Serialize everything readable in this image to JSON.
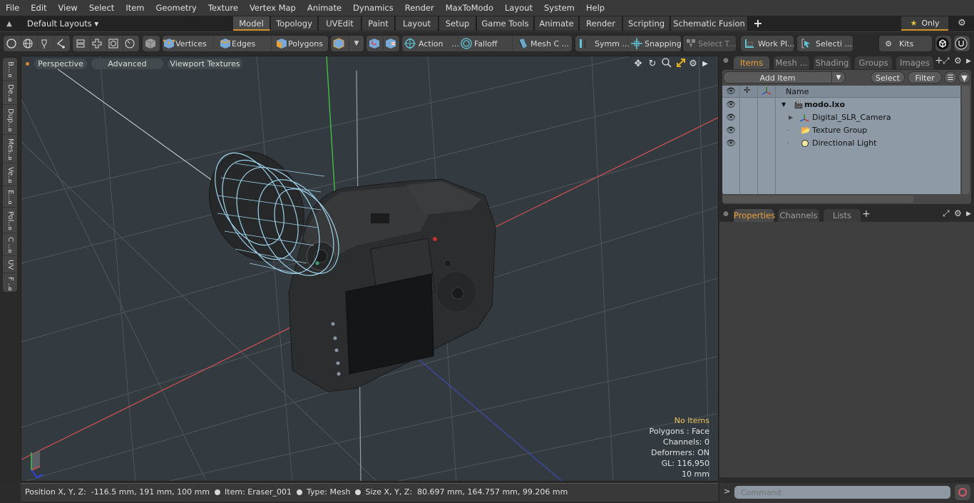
{
  "menu": [
    "File",
    "Edit",
    "View",
    "Select",
    "Item",
    "Geometry",
    "Texture",
    "Vertex Map",
    "Animate",
    "Dynamics",
    "Render",
    "MaxToModo",
    "Layout",
    "System",
    "Help"
  ],
  "layouts": {
    "label": "Default Layouts ▾",
    "tabs": [
      "Model",
      "Topology",
      "UVEdit",
      "Paint",
      "Layout",
      "Setup",
      "Game Tools",
      "Animate",
      "Render",
      "Scripting",
      "Schematic Fusion"
    ],
    "active_tab": "Model",
    "add": "+",
    "only_label": "Only"
  },
  "toolbar": {
    "vertices": "Vertices",
    "edges": "Edges",
    "polygons": "Polygons",
    "action": "Action",
    "falloff": "Falloff",
    "mesh": "Mesh C ...",
    "symmetry": "Symm ...",
    "snapping": "Snapping",
    "select_t": "Select T...",
    "work_plane": "Work Pl...",
    "selection": "Selecti ...",
    "kits": "Kits",
    "ellipsis": "..."
  },
  "left_tabs": [
    "B...",
    "De...",
    "Dup...",
    "Mes...",
    "Ve...",
    "E...",
    "Pol...",
    "C ...",
    "UV",
    "F ..."
  ],
  "viewport": {
    "view_mode": "Perspective",
    "shading": "Advanced",
    "textures": "Viewport Textures",
    "info": {
      "selection": "No Items",
      "polygons": "Polygons : Face",
      "channels": "Channels: 0",
      "deformers": "Deformers: ON",
      "gl": "GL: 116,950",
      "grid": "10 mm"
    }
  },
  "items_panel": {
    "tabs": [
      "Items",
      "Mesh ...",
      "Shading",
      "Groups",
      "Images"
    ],
    "active_tab": "Items",
    "add_item": "Add Item",
    "select": "Select",
    "filter": "Filter",
    "column_name": "Name",
    "tree": [
      {
        "name": "modo.lxo",
        "icon": "scene-clapper-icon",
        "level": 0,
        "expanded": true,
        "bold": true
      },
      {
        "name": "Digital_SLR_Camera",
        "icon": "locator-icon",
        "level": 1,
        "expanded": false
      },
      {
        "name": "Texture Group",
        "icon": "folder-icon",
        "level": 1
      },
      {
        "name": "Directional Light",
        "icon": "light-icon",
        "level": 1
      }
    ]
  },
  "properties_panel": {
    "tabs": [
      "Properties",
      "Channels",
      "Lists"
    ],
    "active_tab": "Properties",
    "add": "+"
  },
  "command": {
    "prompt": ">",
    "placeholder": "Command"
  },
  "status": {
    "position_label": "Position X, Y, Z:",
    "position_value": "-116.5 mm, 191 mm, 100 mm",
    "item_label": "Item:",
    "item_value": "Eraser_001",
    "type_label": "Type:",
    "type_value": "Mesh",
    "size_label": "Size X, Y, Z:",
    "size_value": "80.697 mm, 164.757 mm, 99.206 mm"
  },
  "colors": {
    "accent": "#d9932e",
    "active_tab_text": "#e9a03a",
    "info_highlight": "#e8c35a",
    "wireframe": "#9fd3ea",
    "axis_x": "#d04040",
    "axis_y": "#40c040",
    "axis_z": "#4050d0"
  }
}
